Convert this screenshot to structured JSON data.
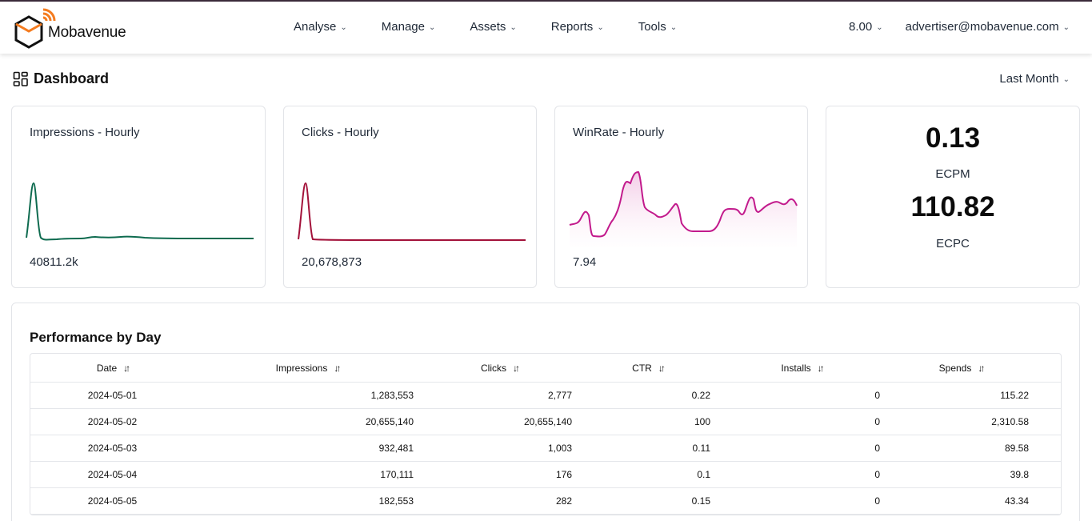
{
  "brand": {
    "name": "Mobavenue"
  },
  "nav": {
    "items": [
      "Analyse",
      "Manage",
      "Assets",
      "Reports",
      "Tools"
    ],
    "balance": "8.00",
    "account": "advertiser@mobavenue.com"
  },
  "page": {
    "title": "Dashboard",
    "period": "Last Month"
  },
  "cards": {
    "impressions": {
      "title": "Impressions - Hourly",
      "value": "40811.2k",
      "color": "#0e6b4f"
    },
    "clicks": {
      "title": "Clicks - Hourly",
      "value": "20,678,873",
      "color": "#a3123a"
    },
    "winrate": {
      "title": "WinRate - Hourly",
      "value": "7.94",
      "color": "#c21a8c"
    }
  },
  "kpis": {
    "ecpm_value": "0.13",
    "ecpm_label": "ECPM",
    "ecpc_value": "110.82",
    "ecpc_label": "ECPC"
  },
  "performance": {
    "title": "Performance by Day",
    "columns": [
      "Date",
      "Impressions",
      "Clicks",
      "CTR",
      "Installs",
      "Spends"
    ],
    "rows": [
      [
        "2024-05-01",
        "1,283,553",
        "2,777",
        "0.22",
        "0",
        "115.22"
      ],
      [
        "2024-05-02",
        "20,655,140",
        "20,655,140",
        "100",
        "0",
        "2,310.58"
      ],
      [
        "2024-05-03",
        "932,481",
        "1,003",
        "0.11",
        "0",
        "89.58"
      ],
      [
        "2024-05-04",
        "170,111",
        "176",
        "0.1",
        "0",
        "39.8"
      ],
      [
        "2024-05-05",
        "182,553",
        "282",
        "0.15",
        "0",
        "43.34"
      ]
    ]
  },
  "icons": {
    "logo": "mobavenue-logo-icon",
    "dashboard": "grid-icon",
    "sort": "sort-arrows-icon",
    "dropdown": "chevron-down-icon"
  }
}
